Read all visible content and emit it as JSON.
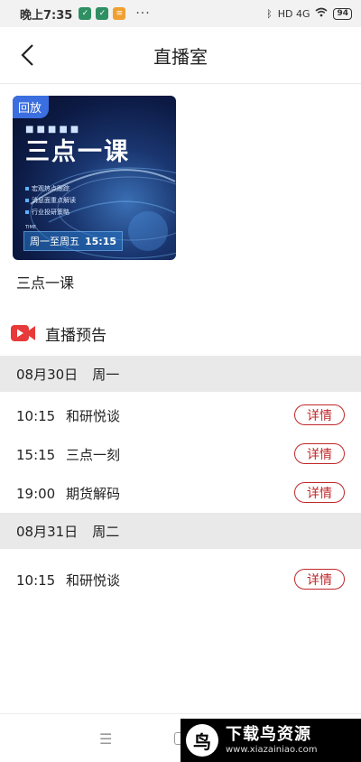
{
  "status_bar": {
    "time": "晚上7:35",
    "more": "···",
    "network": "HD 4G",
    "battery": "94"
  },
  "header": {
    "title": "直播室"
  },
  "replay": {
    "badge": "回放",
    "cover_title": "三点一课",
    "cover_lines": [
      "宏观热点跟踪",
      "消息面重点解读",
      "行业投研策略"
    ],
    "cover_time_label": "TIME",
    "cover_days": "周一至周五",
    "cover_time": "15:15",
    "name": "三点一课"
  },
  "section": {
    "title": "直播预告"
  },
  "schedule": [
    {
      "date": "08月30日",
      "weekday": "周一",
      "items": [
        {
          "time": "10:15",
          "name": "和研悦谈",
          "button": "详情"
        },
        {
          "time": "15:15",
          "name": "三点一刻",
          "button": "详情"
        },
        {
          "time": "19:00",
          "name": "期货解码",
          "button": "详情"
        }
      ]
    },
    {
      "date": "08月31日",
      "weekday": "周二",
      "items": [
        {
          "time": "10:15",
          "name": "和研悦谈",
          "button": "详情"
        }
      ]
    }
  ],
  "nav": {
    "menu_icon": "menu-icon",
    "home_icon": "home-icon"
  },
  "watermark": {
    "brand": "下载鸟资源",
    "url": "www.xiazainiao.com"
  },
  "colors": {
    "accent": "#c0282a",
    "date_row_bg": "#e9e9e9",
    "replay_badge": "#3b6fe0"
  }
}
